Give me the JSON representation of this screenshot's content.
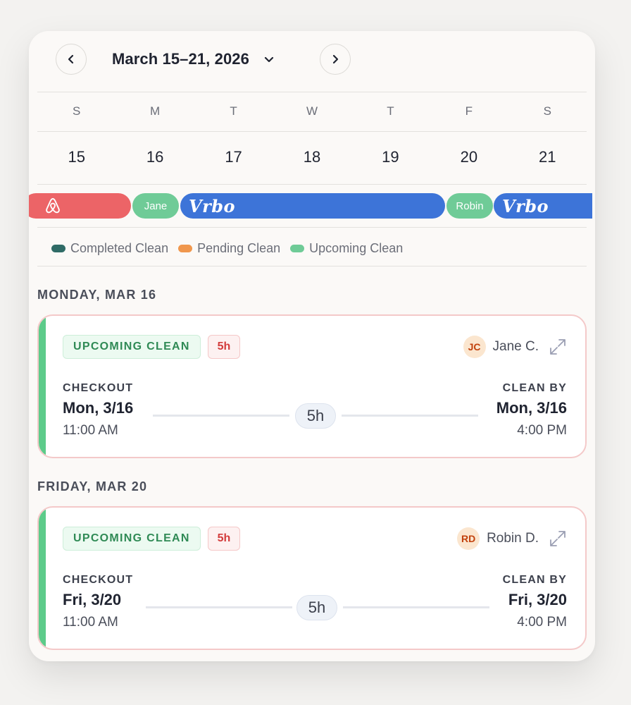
{
  "header": {
    "title": "March 15–21, 2026"
  },
  "calendar": {
    "weekdays": [
      "S",
      "M",
      "T",
      "W",
      "T",
      "F",
      "S"
    ],
    "dates": [
      "15",
      "16",
      "17",
      "18",
      "19",
      "20",
      "21"
    ]
  },
  "bookings": {
    "jane": "Jane",
    "vrbo1": "Vrbo",
    "robin": "Robin",
    "vrbo2": "Vrbo"
  },
  "legend": {
    "completed": "Completed Clean",
    "pending": "Pending Clean",
    "upcoming": "Upcoming Clean",
    "colors": {
      "completed": "#2f6b66",
      "pending": "#f0974d",
      "upcoming": "#6fcb97"
    }
  },
  "sections": [
    {
      "day_label": "MONDAY, MAR 16",
      "status": "UPCOMING CLEAN",
      "hours": "5h",
      "initials": "JC",
      "assignee": "Jane C.",
      "checkout_label": "CHECKOUT",
      "checkout_date": "Mon, 3/16",
      "checkout_time": "11:00 AM",
      "duration": "5h",
      "cleanby_label": "CLEAN BY",
      "cleanby_date": "Mon, 3/16",
      "cleanby_time": "4:00 PM"
    },
    {
      "day_label": "FRIDAY, MAR 20",
      "status": "UPCOMING CLEAN",
      "hours": "5h",
      "initials": "RD",
      "assignee": "Robin D.",
      "checkout_label": "CHECKOUT",
      "checkout_date": "Fri, 3/20",
      "checkout_time": "11:00 AM",
      "duration": "5h",
      "cleanby_label": "CLEAN BY",
      "cleanby_date": "Fri, 3/20",
      "cleanby_time": "4:00 PM"
    }
  ]
}
